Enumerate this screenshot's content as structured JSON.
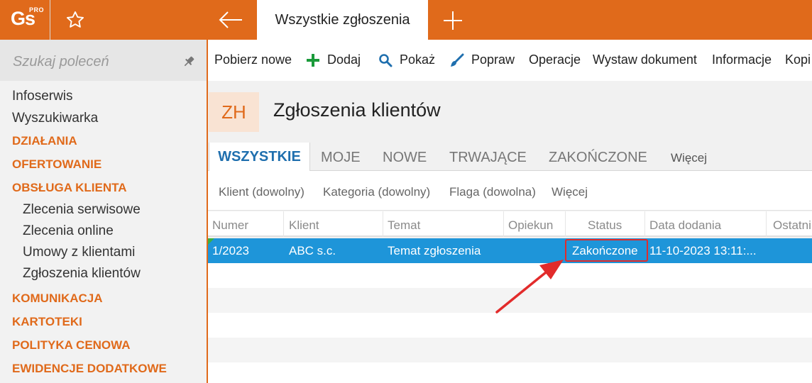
{
  "app": {
    "logo_text": "Gs",
    "logo_sup": "PRO",
    "active_tab": "Wszystkie zgłoszenia"
  },
  "sidebar": {
    "search_placeholder": "Szukaj poleceń",
    "items": [
      {
        "label": "Infoserwis",
        "kind": "item"
      },
      {
        "label": "Wyszukiwarka",
        "kind": "item"
      },
      {
        "label": "DZIAŁANIA",
        "kind": "section"
      },
      {
        "label": "OFERTOWANIE",
        "kind": "section"
      },
      {
        "label": "OBSŁUGA KLIENTA",
        "kind": "section"
      },
      {
        "label": "Zlecenia serwisowe",
        "kind": "sub"
      },
      {
        "label": "Zlecenia online",
        "kind": "sub"
      },
      {
        "label": "Umowy z klientami",
        "kind": "sub"
      },
      {
        "label": "Zgłoszenia klientów",
        "kind": "sub"
      },
      {
        "label": "KOMUNIKACJA",
        "kind": "section"
      },
      {
        "label": "KARTOTEKI",
        "kind": "section"
      },
      {
        "label": "POLITYKA CENOWA",
        "kind": "section"
      },
      {
        "label": "EWIDENCJE DODATKOWE",
        "kind": "section"
      }
    ]
  },
  "toolbar": {
    "items": [
      "Pobierz nowe",
      "Dodaj",
      "Pokaż",
      "Popraw",
      "Operacje",
      "Wystaw dokument",
      "Informacje",
      "Kopi"
    ],
    "colors": {
      "add": "#1a9a3a",
      "search": "#1f6fae",
      "edit": "#1f6fae"
    }
  },
  "page": {
    "code": "ZH",
    "title": "Zgłoszenia klientów"
  },
  "tabs": [
    "WSZYSTKIE",
    "MOJE",
    "NOWE",
    "TRWAJĄCE",
    "ZAKOŃCZONE",
    "Więcej"
  ],
  "filters": [
    "Klient (dowolny)",
    "Kategoria (dowolny)",
    "Flaga (dowolna)",
    "Więcej"
  ],
  "grid": {
    "columns": [
      "Numer",
      "Klient",
      "Temat",
      "Opiekun",
      "Status",
      "Data dodania",
      "Ostatni"
    ],
    "rows": [
      [
        "1/2023",
        "ABC s.c.",
        "Temat zgłoszenia",
        "",
        "Zakończone",
        "11-10-2023 13:11:..."
      ]
    ]
  },
  "colors": {
    "accent": "#e06a1b",
    "selection": "#1e95d9",
    "highlight": "#e22b2b"
  }
}
